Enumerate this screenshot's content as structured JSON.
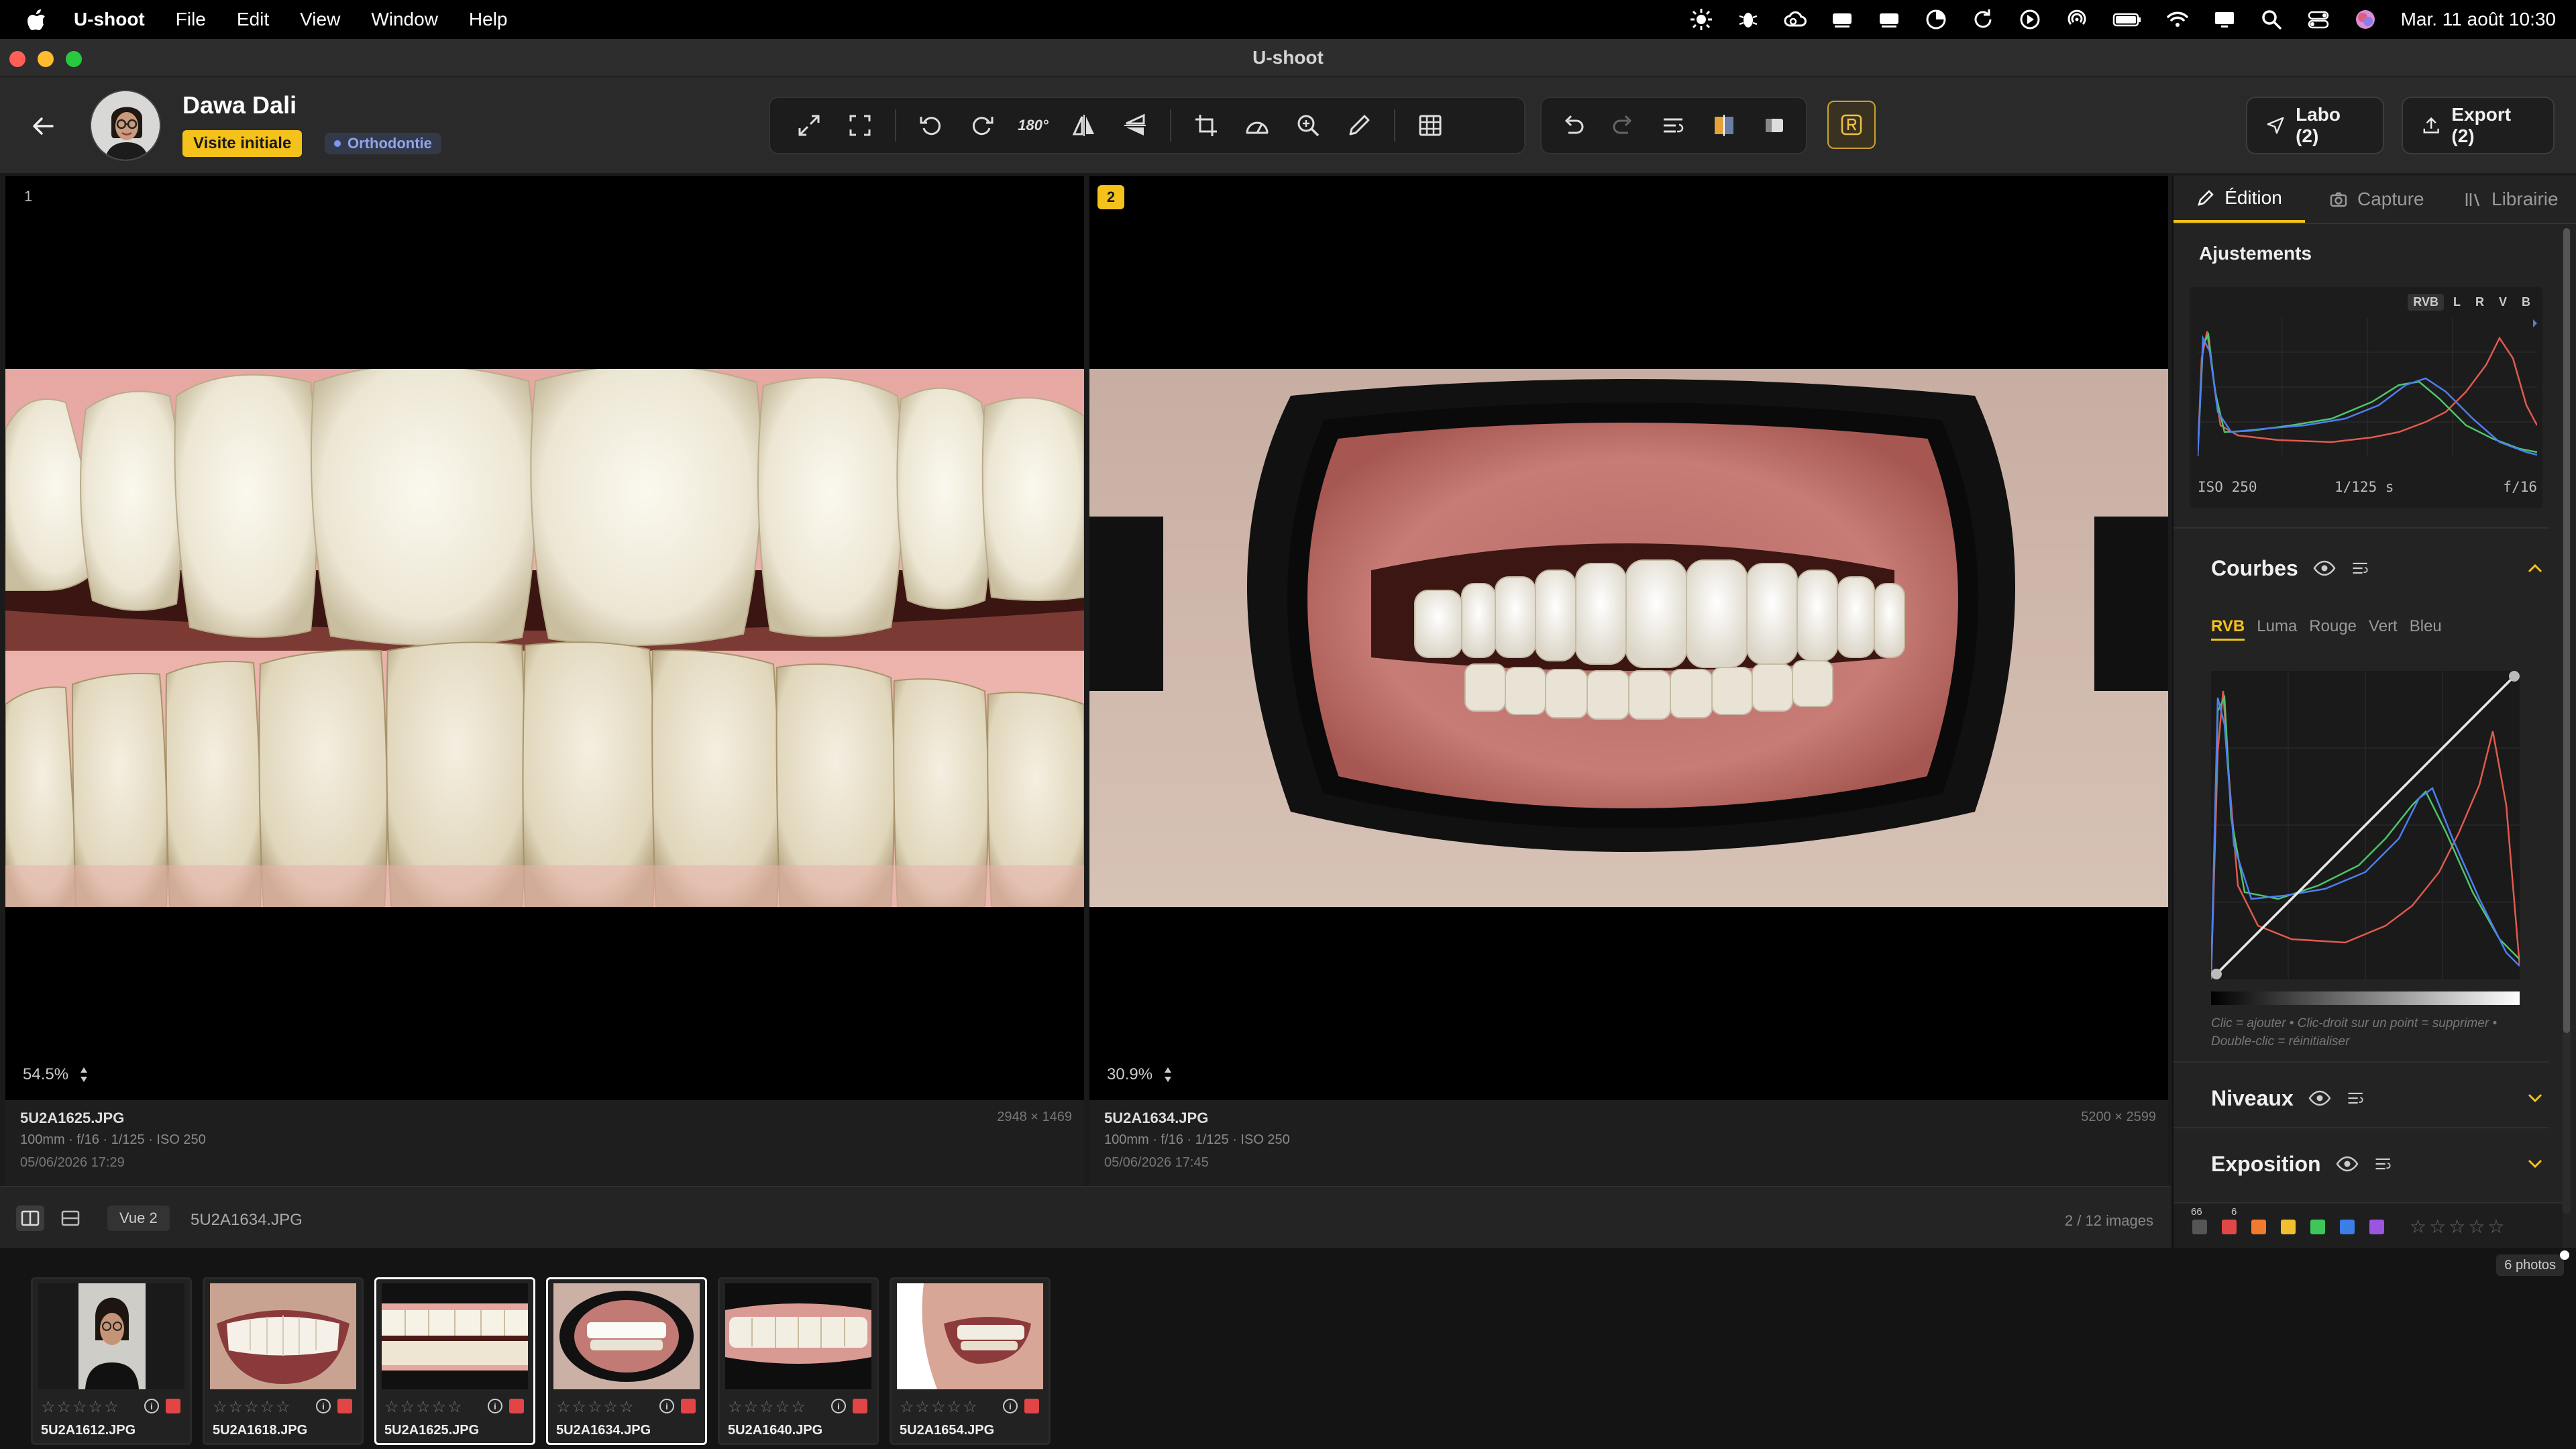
{
  "menubar": {
    "app_name": "U-shoot",
    "menus": [
      "File",
      "Edit",
      "View",
      "Window",
      "Help"
    ],
    "clock": "Mar. 11 août  10:30"
  },
  "window": {
    "title": "U-shoot"
  },
  "patient": {
    "name": "Dawa Dali",
    "visit_badge": "Visite initiale",
    "specialty_badge": "Orthodontie"
  },
  "actions": {
    "labo": "Labo (2)",
    "export": "Export (2)"
  },
  "toolbar": {
    "rotate_180_label": "180°"
  },
  "viewers": [
    {
      "index": "1",
      "zoom": "54.5%",
      "filename": "5U2A1625.JPG",
      "dimensions": "2948 × 1469",
      "exif": "100mm · f/16 · 1/125 · ISO 250",
      "date": "05/06/2026 17:29",
      "selected": false
    },
    {
      "index": "2",
      "zoom": "30.9%",
      "filename": "5U2A1634.JPG",
      "dimensions": "5200 × 2599",
      "exif": "100mm · f/16 · 1/125 · ISO 250",
      "date": "05/06/2026 17:45",
      "selected": true
    }
  ],
  "viewbar": {
    "view_label": "Vue 2",
    "current_file": "5U2A1634.JPG",
    "count": "2 / 12 images"
  },
  "side": {
    "tabs": [
      "Édition",
      "Capture",
      "Librairie"
    ],
    "active_tab": "Édition",
    "adjustments_title": "Ajustements",
    "histogram_channels": [
      "RVB",
      "L",
      "R",
      "V",
      "B"
    ],
    "iso": "ISO 250",
    "shutter": "1/125 s",
    "aperture": "f/16",
    "curves": {
      "title": "Courbes",
      "channels": [
        "RVB",
        "Luma",
        "Rouge",
        "Vert",
        "Bleu"
      ],
      "active_channel": "RVB",
      "hint": "Clic = ajouter • Clic-droit sur un point = supprimer • Double-clic = réinitialiser"
    },
    "levels_title": "Niveaux",
    "exposure_title": "Exposition",
    "label_counts": {
      "all": "66",
      "red": "6"
    },
    "label_colors": [
      "#e04848",
      "#f07a30",
      "#f0c030",
      "#3ec65a",
      "#3b7fe6",
      "#9b55e0"
    ]
  },
  "film": {
    "count_badge": "6 photos",
    "thumbs": [
      {
        "name": "5U2A1612.JPG",
        "stars": "☆☆☆☆☆",
        "selected": false
      },
      {
        "name": "5U2A1618.JPG",
        "stars": "☆☆☆☆☆",
        "selected": false
      },
      {
        "name": "5U2A1625.JPG",
        "stars": "☆☆☆☆☆",
        "selected": true
      },
      {
        "name": "5U2A1634.JPG",
        "stars": "☆☆☆☆☆",
        "selected": true
      },
      {
        "name": "5U2A1640.JPG",
        "stars": "☆☆☆☆☆",
        "selected": false
      },
      {
        "name": "5U2A1654.JPG",
        "stars": "☆☆☆☆☆",
        "selected": false
      }
    ]
  }
}
